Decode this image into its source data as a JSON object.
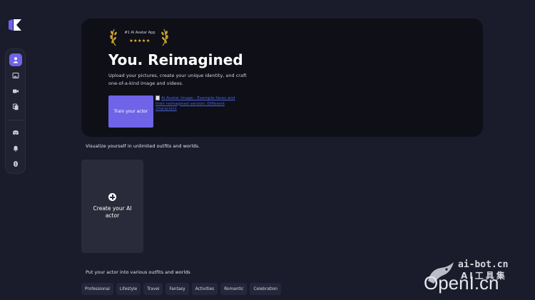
{
  "sidebar": {
    "items": [
      {
        "icon": "user-icon",
        "active": true
      },
      {
        "icon": "image-gallery-icon",
        "active": false
      },
      {
        "icon": "video-camera-icon",
        "active": false
      },
      {
        "icon": "copy-icon",
        "active": false
      },
      {
        "icon": "discord-icon",
        "active": false
      },
      {
        "icon": "bell-icon",
        "active": false
      },
      {
        "icon": "credits-icon",
        "active": false
      }
    ]
  },
  "hero": {
    "badge": "#1 AI Avatar App",
    "stars": "★★★★★",
    "title": "You. Reimagined",
    "subtitle_line1": "Upload your pictures, create your unique identity, and craft",
    "subtitle_line2": "one-of-a-kind image and videos.",
    "cta_label": "Train your actor",
    "image_alt": "Ai Avatar Image - Example faces and their reimagined version: Different characters"
  },
  "visualize_label": "Visualize yourself in unlimited outfits and worlds.",
  "create_card": {
    "label": "Create your AI actor"
  },
  "outfits_label": "Put your actor into various outfits and worlds",
  "chips": [
    "Professional",
    "Lifestyle",
    "Travel",
    "Fantasy",
    "Activities",
    "Romantic",
    "Celebration"
  ],
  "watermark": {
    "top": "ai-bot.cn",
    "cn": "AI工具集",
    "main": "OpenI.cn"
  },
  "colors": {
    "background": "#1a1b2b",
    "accent": "#6f63e8",
    "hero_bg": "#0f0f18",
    "card_bg": "#2a2b3a",
    "star": "#f2c230"
  }
}
